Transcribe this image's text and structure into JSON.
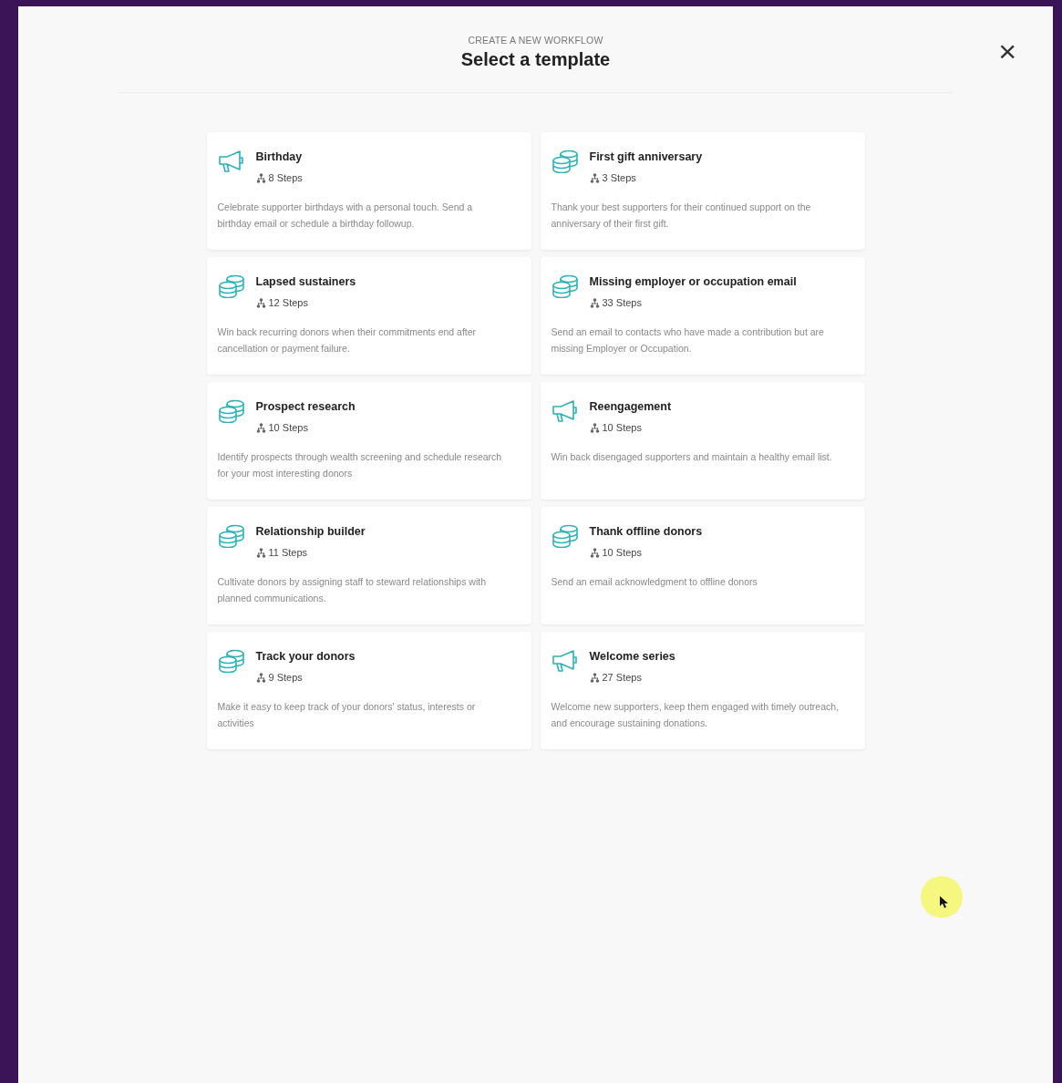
{
  "header": {
    "eyebrow": "CREATE A NEW WORKFLOW",
    "title": "Select a template",
    "close": "×"
  },
  "templates": [
    {
      "kind": "outreach",
      "name": "Birthday",
      "steps": "8 Steps",
      "description": "Celebrate supporter birthdays with a personal touch. Send a birthday email or schedule a birthday followup."
    },
    {
      "kind": "donor",
      "name": "First gift anniversary",
      "steps": "3 Steps",
      "description": "Thank your best supporters for their continued support on the anniversary of their first gift."
    },
    {
      "kind": "donor",
      "name": "Lapsed sustainers",
      "steps": "12 Steps",
      "description": "Win back recurring donors when their commitments end after cancellation or payment failure."
    },
    {
      "kind": "donor",
      "name": "Missing employer or occupation email",
      "steps": "33 Steps",
      "description": "Send an email to contacts who have made a contribution but are missing Employer or Occupation."
    },
    {
      "kind": "donor",
      "name": "Prospect research",
      "steps": "10 Steps",
      "description": "Identify prospects through wealth screening and schedule research for your most interesting donors"
    },
    {
      "kind": "outreach",
      "name": "Reengagement",
      "steps": "10 Steps",
      "description": "Win back disengaged supporters and maintain a healthy email list."
    },
    {
      "kind": "donor",
      "name": "Relationship builder",
      "steps": "11 Steps",
      "description": "Cultivate donors by assigning staff to steward relationships with planned communications."
    },
    {
      "kind": "donor",
      "name": "Thank offline donors",
      "steps": "10 Steps",
      "description": "Send an email acknowledgment to offline donors"
    },
    {
      "kind": "donor",
      "name": "Track your donors",
      "steps": "9 Steps",
      "description": "Make it easy to keep track of your donors' status, interests or activities"
    },
    {
      "kind": "outreach",
      "name": "Welcome series",
      "steps": "27 Steps",
      "description": "Welcome new supporters, keep them engaged with timely outreach, and encourage sustaining donations."
    }
  ]
}
